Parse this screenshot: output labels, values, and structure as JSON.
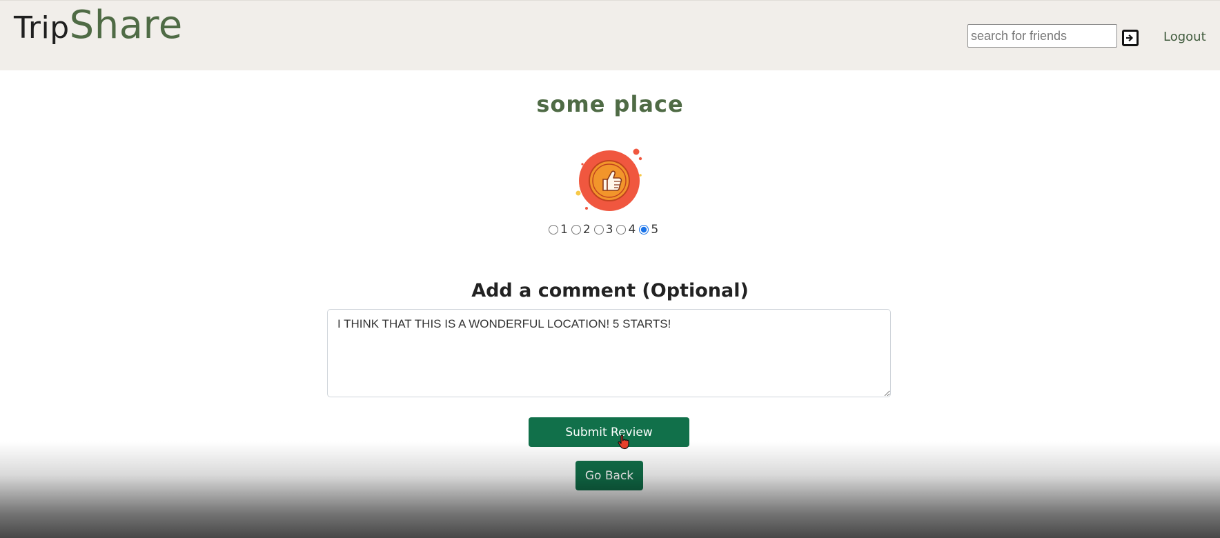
{
  "header": {
    "brand_part1": "Trip",
    "brand_part2": "Share",
    "search_placeholder": "search for friends",
    "search_button_icon": "sign-in-icon",
    "logout_label": "Logout"
  },
  "place": {
    "title": "some place"
  },
  "rating": {
    "icon": "thumbs-up-badge-icon",
    "options": [
      "1",
      "2",
      "3",
      "4",
      "5"
    ],
    "selected": "5"
  },
  "comment": {
    "label": "Add a comment (Optional)",
    "value": "I THINK THAT THIS IS A WONDERFUL LOCATION! 5 STARTS!"
  },
  "actions": {
    "submit_label": "Submit Review",
    "back_label": "Go Back"
  },
  "colors": {
    "brand_green": "#4f6b45",
    "button_green": "#11704a",
    "header_bg": "#f1eeea",
    "badge_red": "#f0573f",
    "badge_orange": "#f2952b"
  }
}
